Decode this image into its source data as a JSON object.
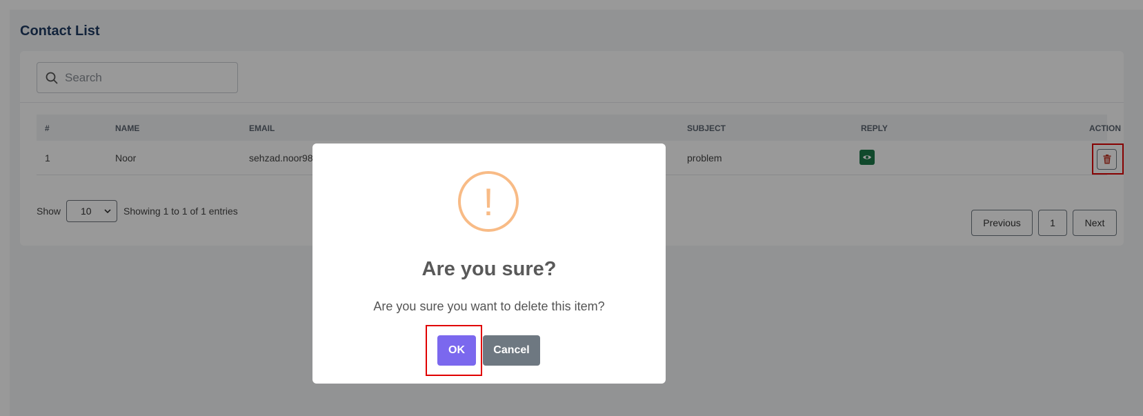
{
  "page": {
    "title": "Contact List"
  },
  "search": {
    "placeholder": "Search",
    "icon": "search-icon"
  },
  "table": {
    "headers": [
      "#",
      "NAME",
      "EMAIL",
      "SUBJECT",
      "REPLY",
      "ACTION"
    ],
    "rows": [
      {
        "num": "1",
        "name": "Noor",
        "email": "sehzad.noor98",
        "subject": "problem",
        "reply_icon": "eye-icon",
        "action_icon": "trash-icon"
      }
    ]
  },
  "footer": {
    "show_label": "Show",
    "page_size": "10",
    "showing_text": "Showing 1 to 1 of 1 entries"
  },
  "pagination": {
    "previous": "Previous",
    "page": "1",
    "next": "Next"
  },
  "modal": {
    "icon": "warning-icon",
    "icon_glyph": "!",
    "title": "Are you sure?",
    "text": "Are you sure you want to delete this item?",
    "ok_label": "OK",
    "cancel_label": "Cancel"
  },
  "colors": {
    "title": "#1f3b63",
    "reply_button": "#1d7a4a",
    "delete_icon": "#c0392b",
    "ok_button": "#7b68ee",
    "cancel_button": "#6e7881",
    "warning": "#f8bb86",
    "highlight": "#e00000"
  }
}
